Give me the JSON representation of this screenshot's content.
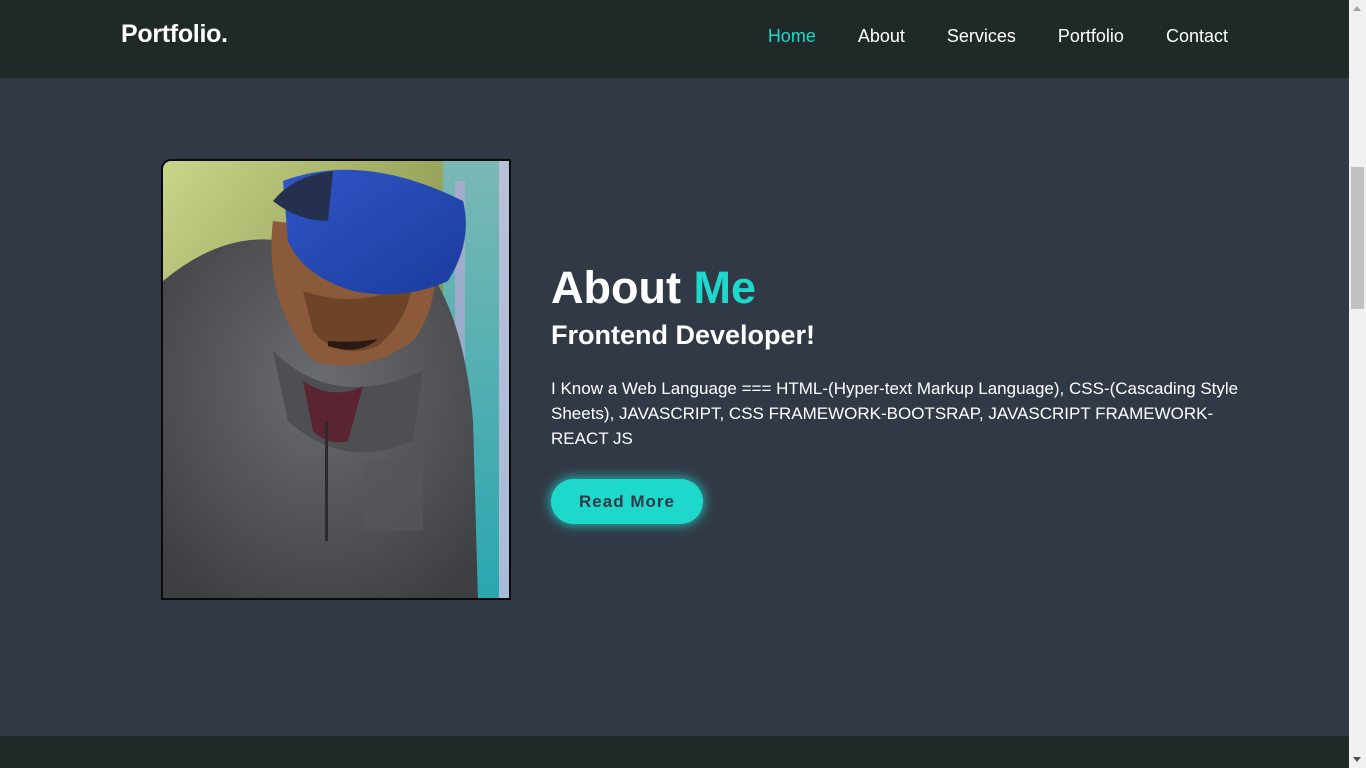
{
  "header": {
    "logo": "Portfolio.",
    "nav": [
      {
        "label": "Home",
        "active": true
      },
      {
        "label": "About",
        "active": false
      },
      {
        "label": "Services",
        "active": false
      },
      {
        "label": "Portfolio",
        "active": false
      },
      {
        "label": "Contact",
        "active": false
      }
    ]
  },
  "about": {
    "title_main": "About",
    "title_accent": "Me",
    "subtitle": "Frontend Developer!",
    "description": "I Know a Web Language === HTML-(Hyper-text Markup Language), CSS-(Cascading Style Sheets), JAVASCRIPT, CSS FRAMEWORK-BOOTSRAP, JAVASCRIPT FRAMEWORK-REACT JS",
    "button_label": "Read More"
  },
  "colors": {
    "accent": "#1ed8cb",
    "background": "#323946",
    "header_bg": "#1f2a28",
    "text": "#ffffff"
  }
}
